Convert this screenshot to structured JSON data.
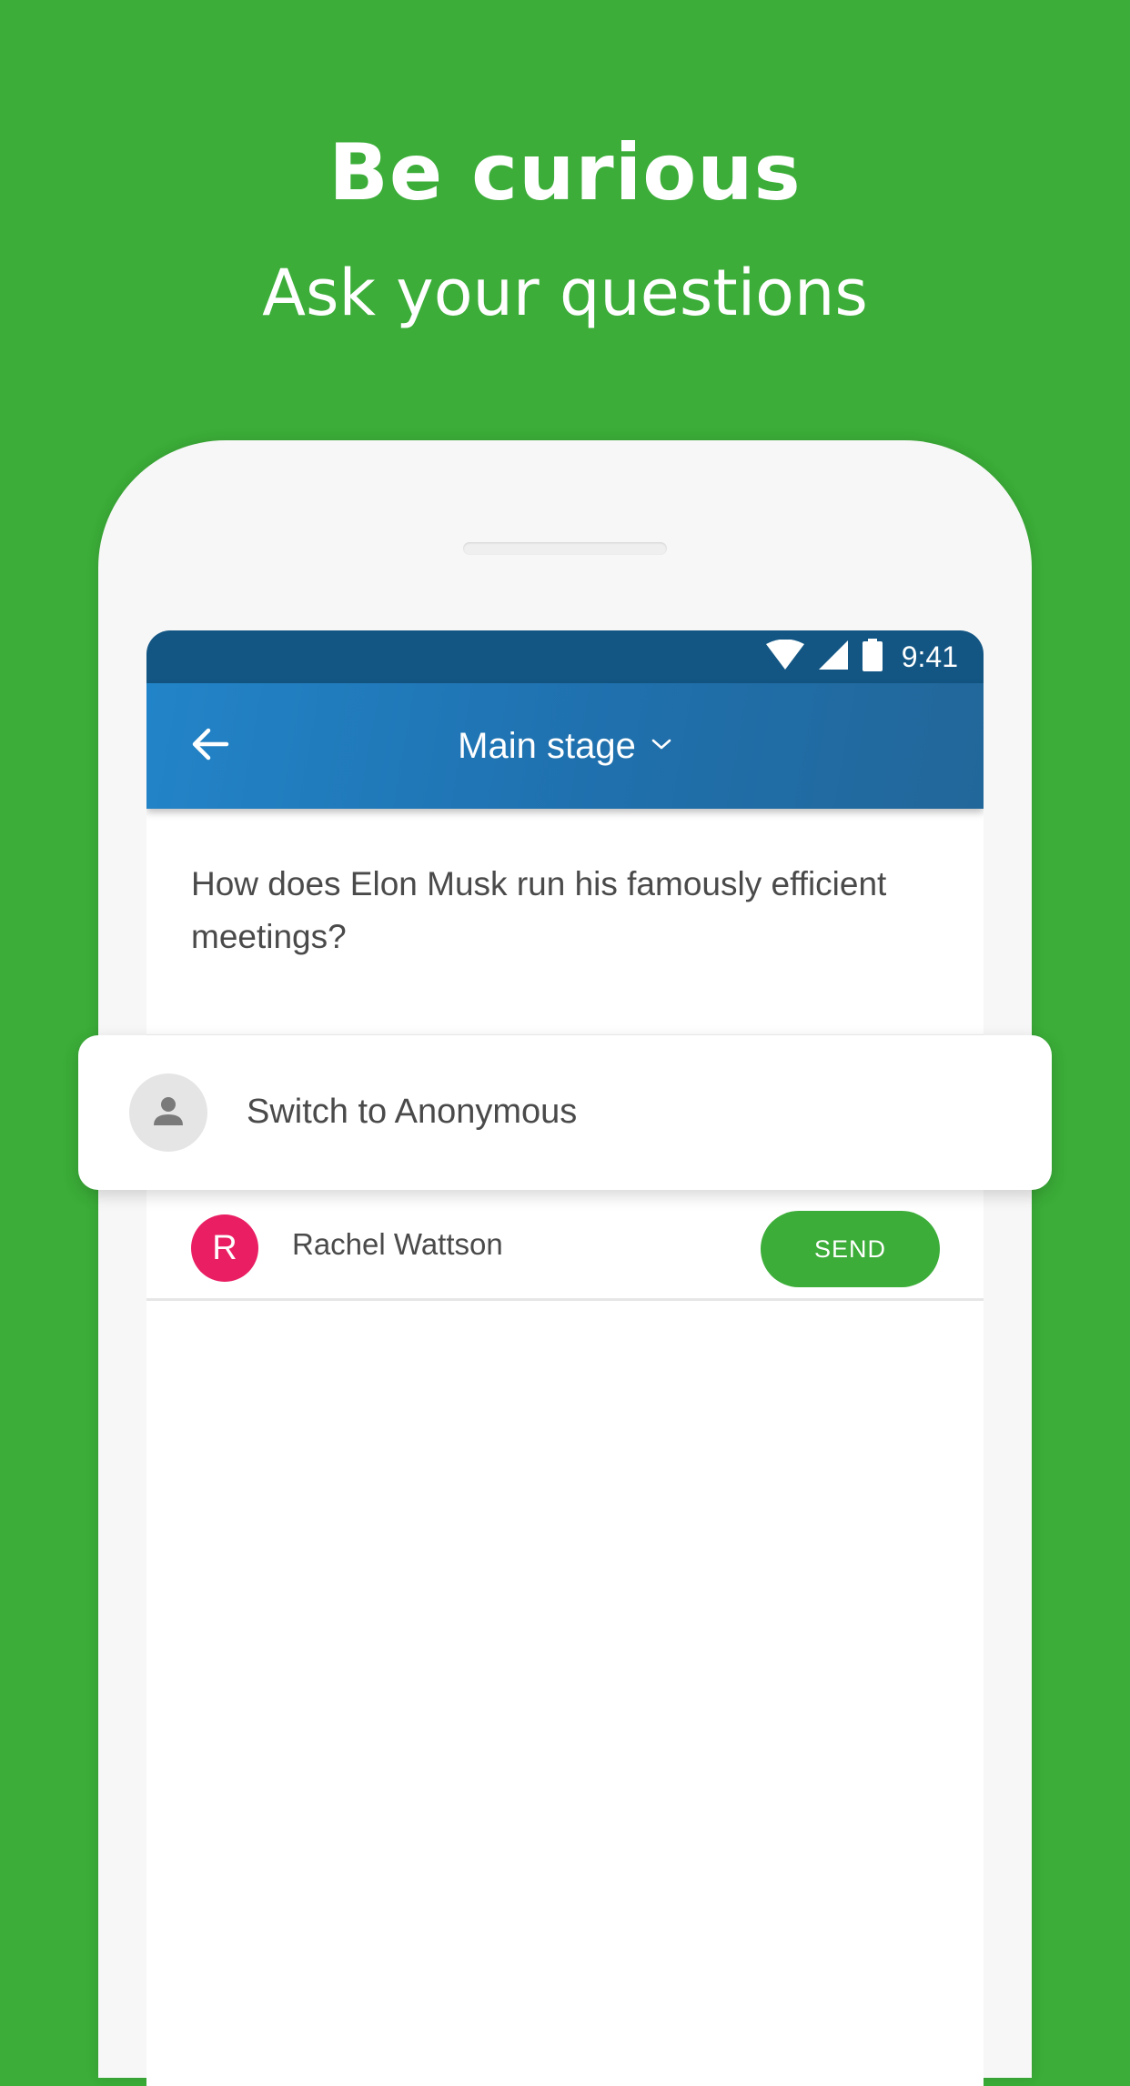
{
  "promo": {
    "headline": "Be curious",
    "subheadline": "Ask your questions"
  },
  "status_bar": {
    "time": "9:41",
    "icons": [
      "wifi-icon",
      "cell-signal-icon",
      "battery-icon"
    ]
  },
  "app_bar": {
    "back_icon": "back-arrow-icon",
    "title": "Main stage",
    "dropdown_icon": "chevron-down-icon"
  },
  "question": {
    "text": "How does Elon Musk run his famously efficient meetings?"
  },
  "anonymous_option": {
    "label": "Switch to Anonymous",
    "icon": "person-icon"
  },
  "sender": {
    "initial": "R",
    "name": "Rachel Wattson",
    "send_label": "SEND"
  },
  "colors": {
    "brand_green": "#3bad38",
    "status_bar": "#135684",
    "app_bar": "#2284c8",
    "avatar_pink": "#e91e63"
  }
}
